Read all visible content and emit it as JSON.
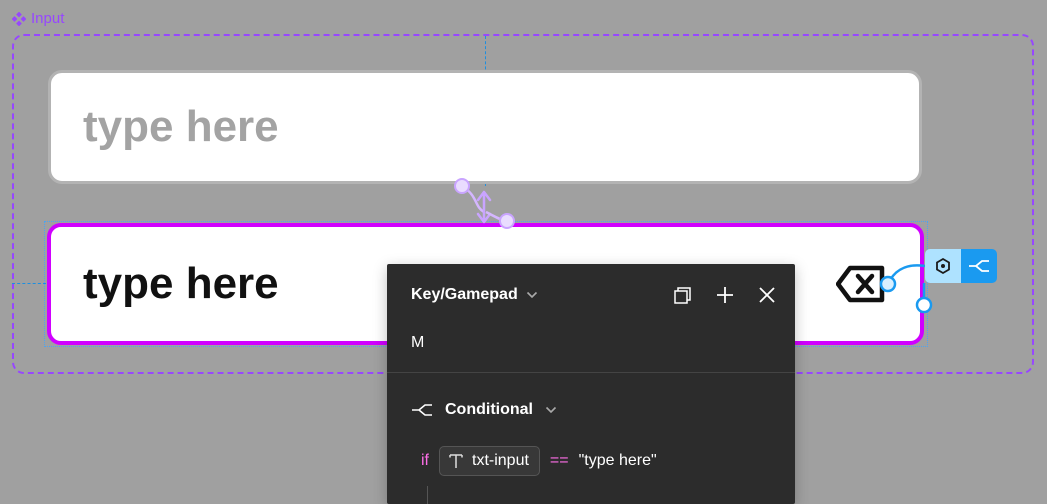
{
  "component": {
    "label": "Input",
    "icon": "component-diamond-icon"
  },
  "inputs": {
    "default_placeholder": "type here",
    "active_value": "type here"
  },
  "interaction_panel": {
    "trigger": "Key/Gamepad",
    "key": "M",
    "actions": {
      "copy_icon": "copy-icon",
      "add_icon": "plus-icon",
      "close_icon": "close-icon"
    },
    "conditional": {
      "label": "Conditional",
      "if_keyword": "if",
      "variable": "txt-input",
      "operator": "==",
      "value": "\"type here\""
    }
  },
  "colors": {
    "canvas": "#a0a0a0",
    "component_purple": "#9747ff",
    "active_border": "#d000ff",
    "prototype_blue": "#1a9af0",
    "panel_bg": "#2c2c2c",
    "keyword_pink": "#ff6ee8"
  }
}
